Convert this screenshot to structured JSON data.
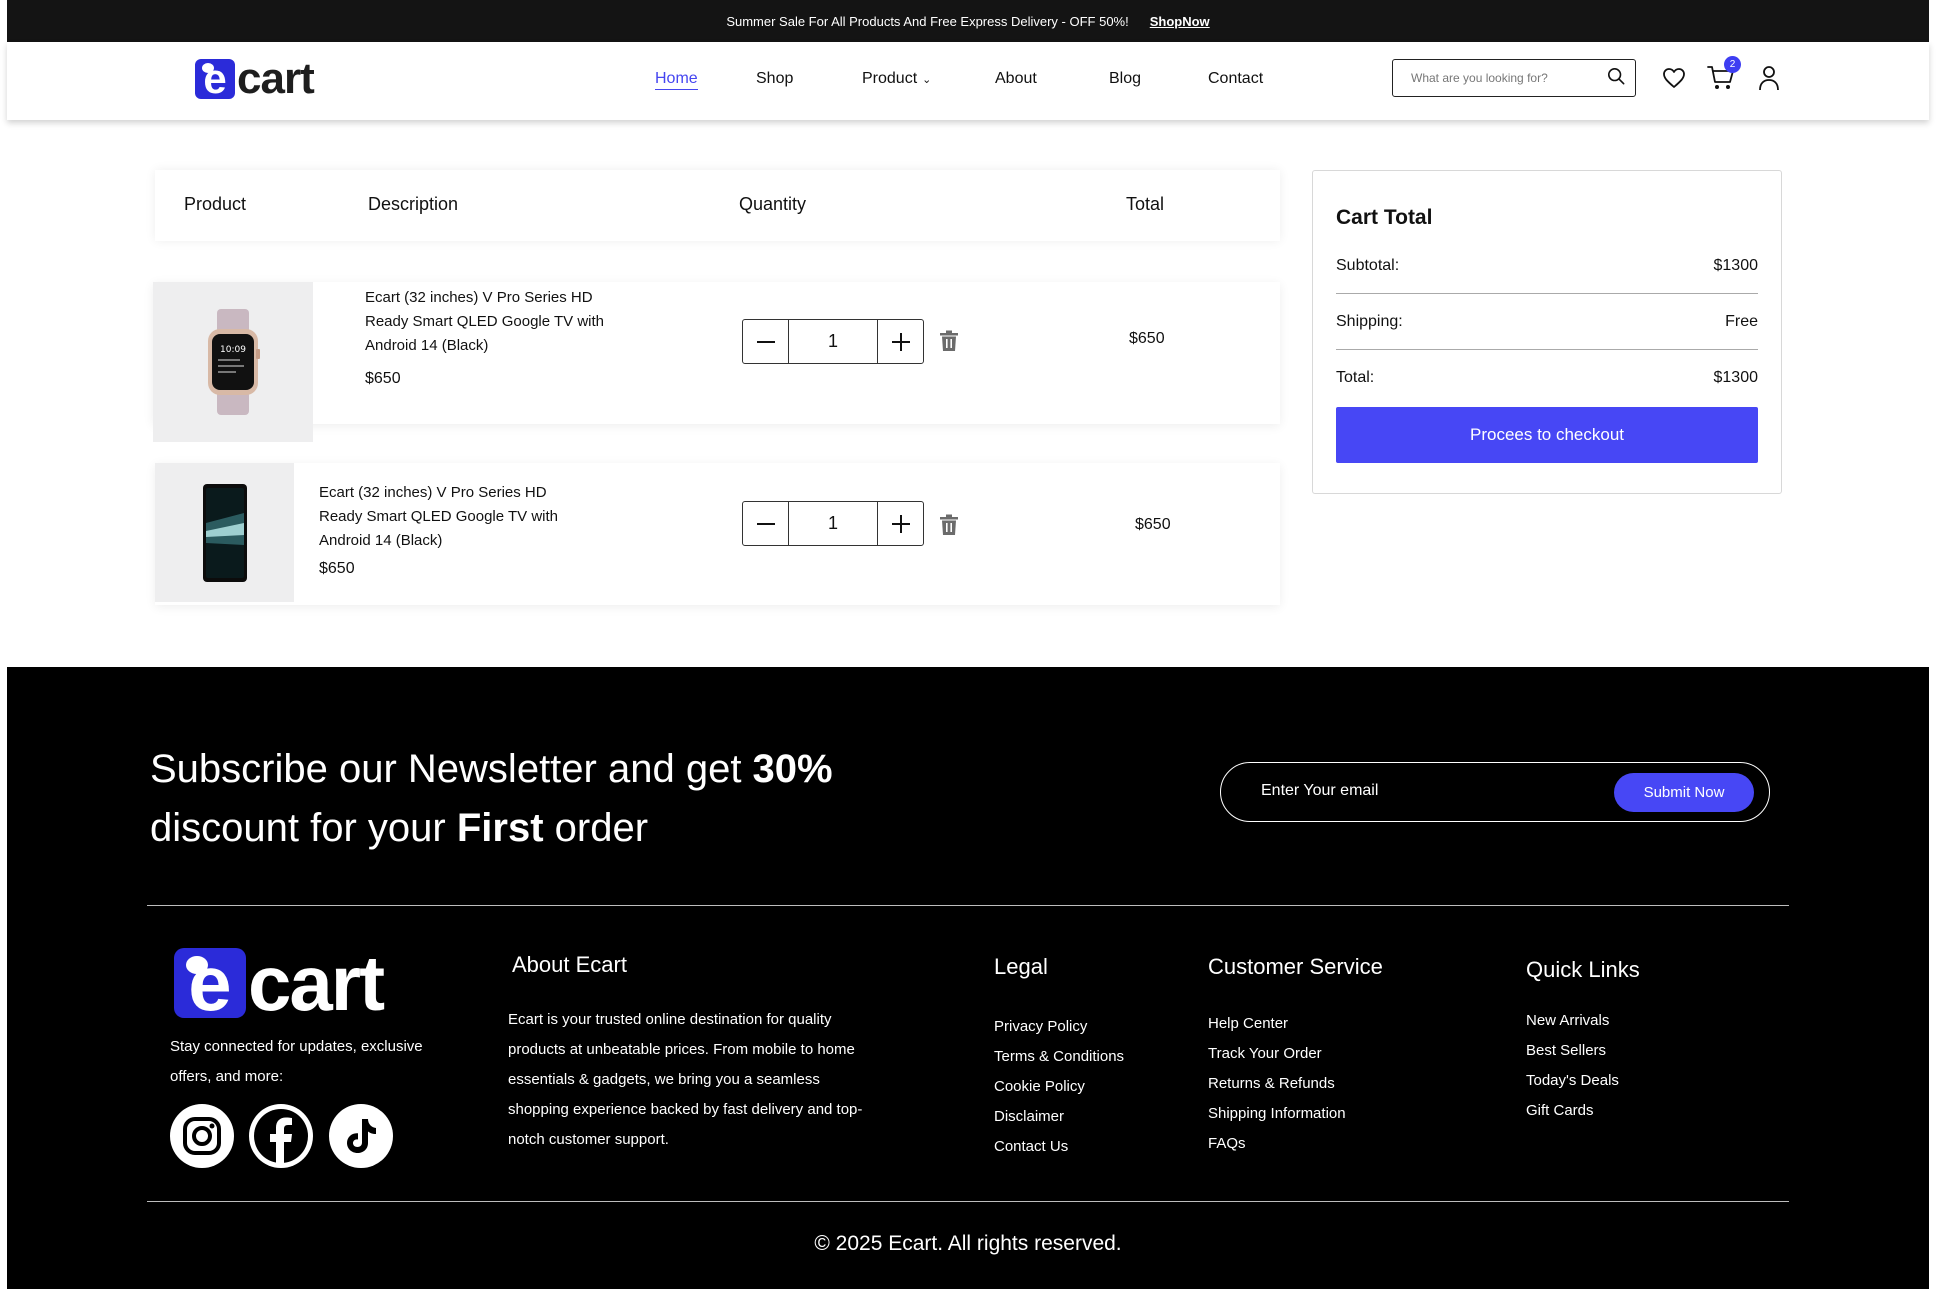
{
  "topbar": {
    "message": "Summer Sale For All Products And Free Express Delivery - OFF 50%!",
    "link": "ShopNow"
  },
  "header": {
    "logo": {
      "mark": "e",
      "word": "cart"
    },
    "nav": [
      "Home",
      "Shop",
      "Product",
      "About",
      "Blog",
      "Contact"
    ],
    "active_nav": "Home",
    "search_placeholder": "What are you looking for?",
    "cart_count": "2",
    "accent_color": "#4545f0"
  },
  "cart": {
    "columns": [
      "Product",
      "Description",
      "Quantity",
      "Total"
    ],
    "items": [
      {
        "image": "smartwatch",
        "description": "Ecart (32 inches) V Pro Series HD Ready Smart QLED Google TV with Android 14 (Black)",
        "price": "$650",
        "quantity": "1",
        "total": "$650"
      },
      {
        "image": "smartphone",
        "description": "Ecart (32 inches) V Pro Series HD Ready Smart QLED Google TV with Android 14 (Black)",
        "price": "$650",
        "quantity": "1",
        "total": "$650"
      }
    ]
  },
  "summary": {
    "title": "Cart Total",
    "subtotal_label": "Subtotal:",
    "subtotal_value": "$1300",
    "shipping_label": "Shipping:",
    "shipping_value": "Free",
    "total_label": "Total:",
    "total_value": "$1300",
    "checkout_label": "Procees to checkout",
    "button_color": "#4747f5"
  },
  "newsletter": {
    "line1_pre": "Subscribe our Newsletter and get ",
    "line1_bold": "30%",
    "line2_pre": "discount for your ",
    "line2_bold": "First",
    "line2_post": " order",
    "email_placeholder": "Enter Your email",
    "submit_label": "Submit Now"
  },
  "footer": {
    "logo": {
      "mark": "e",
      "word": "cart"
    },
    "tagline": "Stay connected for updates, exclusive offers, and more:",
    "social": [
      "instagram-icon",
      "facebook-icon",
      "tiktok-icon"
    ],
    "about_title": "About Ecart",
    "about_text": "Ecart is your trusted online destination for quality products at unbeatable prices. From mobile to home essentials & gadgets, we bring you a seamless shopping experience backed by fast delivery and top-notch customer support.",
    "legal_title": "Legal",
    "legal_links": [
      "Privacy Policy",
      "Terms & Conditions",
      "Cookie Policy",
      "Disclaimer",
      "Contact Us"
    ],
    "service_title": "Customer Service",
    "service_links": [
      "Help Center",
      "Track Your Order",
      "Returns & Refunds",
      "Shipping Information",
      "FAQs"
    ],
    "quick_title": "Quick Links",
    "quick_links": [
      "New Arrivals",
      "Best Sellers",
      "Today's Deals",
      "Gift Cards"
    ],
    "copyright": "© 2025 Ecart. All rights reserved."
  }
}
